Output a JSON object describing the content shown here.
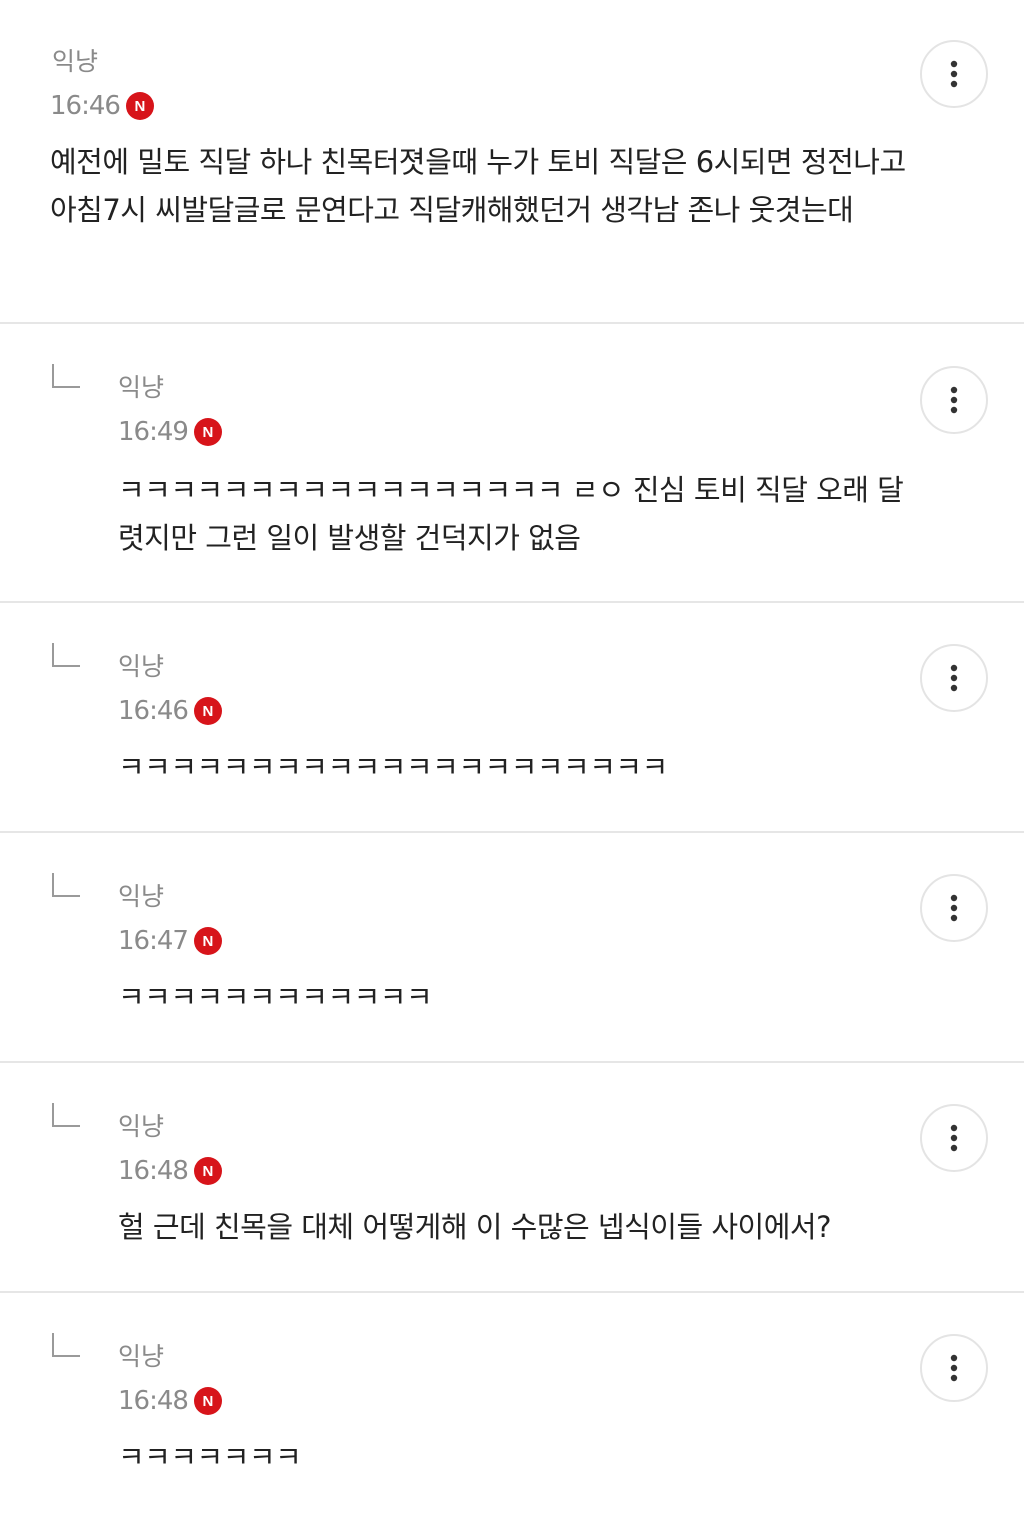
{
  "comments": [
    {
      "author": "익냥",
      "time": "16:46",
      "badge": "N",
      "text": "예전에 밀토 직달 하나 친목터졋을때 누가 토비 직달은 6시되면 정전나고 아침7시 씨발달글로 문연다고 직달캐해했던거 생각남 존나 웃겻는대",
      "is_reply": false
    },
    {
      "author": "익냥",
      "time": "16:49",
      "badge": "N",
      "text": "ㅋㅋㅋㅋㅋㅋㅋㅋㅋㅋㅋㅋㅋㅋㅋㅋㅋ ㄹㅇ 진심 토비 직달 오래 달렷지만 그런 일이 발생할 건덕지가 없음",
      "is_reply": true
    },
    {
      "author": "익냥",
      "time": "16:46",
      "badge": "N",
      "text": "ㅋㅋㅋㅋㅋㅋㅋㅋㅋㅋㅋㅋㅋㅋㅋㅋㅋㅋㅋㅋㅋ",
      "is_reply": true
    },
    {
      "author": "익냥",
      "time": "16:47",
      "badge": "N",
      "text": "ㅋㅋㅋㅋㅋㅋㅋㅋㅋㅋㅋㅋ",
      "is_reply": true
    },
    {
      "author": "익냥",
      "time": "16:48",
      "badge": "N",
      "text": "헐 근데 친목을 대체 어떻게해 이 수많은 넵식이들 사이에서?",
      "is_reply": true
    },
    {
      "author": "익냥",
      "time": "16:48",
      "badge": "N",
      "text": "ㅋㅋㅋㅋㅋㅋㅋ",
      "is_reply": true
    }
  ],
  "icons": {
    "more": "more-vertical-icon",
    "reply": "reply-arrow-icon"
  },
  "colors": {
    "badge": "#d7141a",
    "meta_text": "#8a8a8a",
    "body_text": "#222222",
    "divider": "#e6e6e6"
  }
}
